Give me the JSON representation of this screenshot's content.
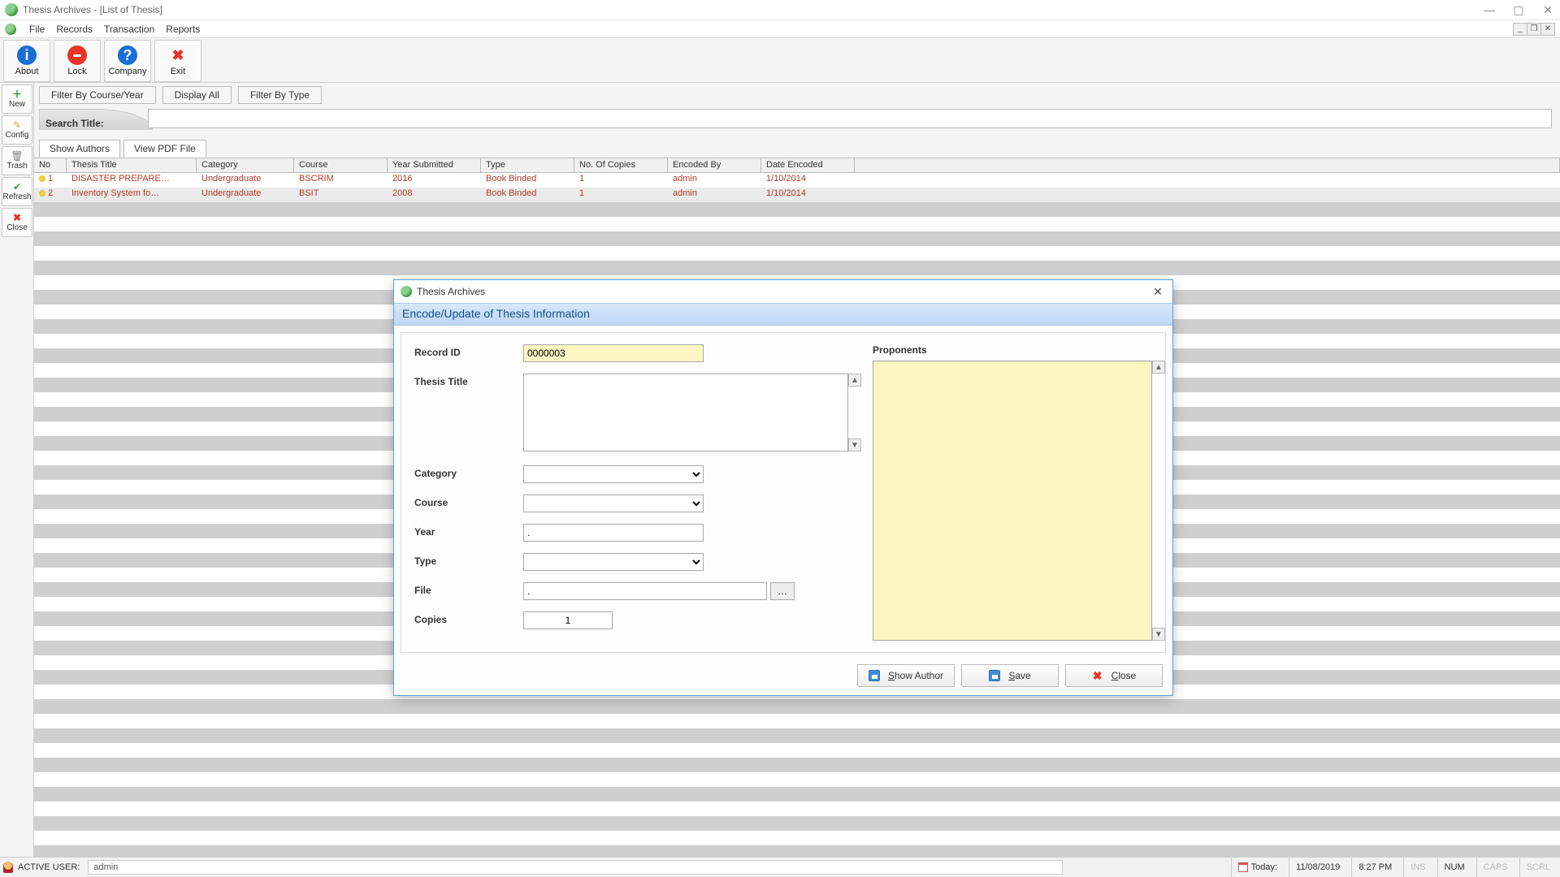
{
  "window": {
    "title": "Thesis Archives - [List of Thesis]"
  },
  "menubar": {
    "file": "File",
    "records": "Records",
    "transaction": "Transaction",
    "reports": "Reports"
  },
  "toolbar": {
    "about": "About",
    "lock": "Lock",
    "company": "Company",
    "exit": "Exit"
  },
  "sidetool": {
    "newLabel": "New",
    "configLabel": "Config",
    "trashLabel": "Trash",
    "refreshLabel": "Refresh",
    "closeLabel": "Close"
  },
  "filters": {
    "byCourseYear": "Filter By Course/Year",
    "displayAll": "Display All",
    "byType": "Filter By Type"
  },
  "search": {
    "label": "Search Title:",
    "value": ""
  },
  "tabs": {
    "showAuthors": "Show Authors",
    "viewPdf": "View PDF File"
  },
  "grid": {
    "headers": {
      "no": "No",
      "thesisTitle": "Thesis Title",
      "category": "Category",
      "course": "Course",
      "yearSubmitted": "Year Submitted",
      "type": "Type",
      "copies": "No. Of Copies",
      "encodedBy": "Encoded By",
      "dateEncoded": "Date Encoded"
    },
    "rows": [
      {
        "no": "1",
        "title": "DISASTER PREPARE…",
        "category": "Undergraduate",
        "course": "BSCRIM",
        "year": "2016",
        "type": "Book Binded",
        "copies": "1",
        "encodedBy": "admin",
        "dateEncoded": "1/10/2014"
      },
      {
        "no": "2",
        "title": "Inventory System fo…",
        "category": "Undergraduate",
        "course": "BSIT",
        "year": "2008",
        "type": "Book Binded",
        "copies": "1",
        "encodedBy": "admin",
        "dateEncoded": "1/10/2014"
      }
    ]
  },
  "dialog": {
    "windowTitle": "Thesis Archives",
    "header": "Encode/Update of Thesis Information",
    "labels": {
      "recordId": "Record ID",
      "thesisTitle": "Thesis Title",
      "category": "Category",
      "course": "Course",
      "year": "Year",
      "type": "Type",
      "file": "File",
      "copies": "Copies",
      "proponents": "Proponents"
    },
    "values": {
      "recordId": "0000003",
      "thesisTitle": "",
      "category": "",
      "course": "",
      "year": ".",
      "type": "",
      "file": ".",
      "copies": "1",
      "proponents": ""
    },
    "browseBtn": "…",
    "buttons": {
      "showAuthor": "Show Author",
      "save": "Save",
      "close": "Close",
      "showAuthorKey": "S",
      "saveKey": "S",
      "closeKey": "C"
    }
  },
  "status": {
    "activeUserLabel": "ACTIVE USER:",
    "activeUser": "admin",
    "todayLabel": "Today:",
    "date": "11/08/2019",
    "time": "8:27 PM",
    "ins": "INS",
    "num": "NUM",
    "caps": "CAPS",
    "scrl": "SCRL"
  }
}
